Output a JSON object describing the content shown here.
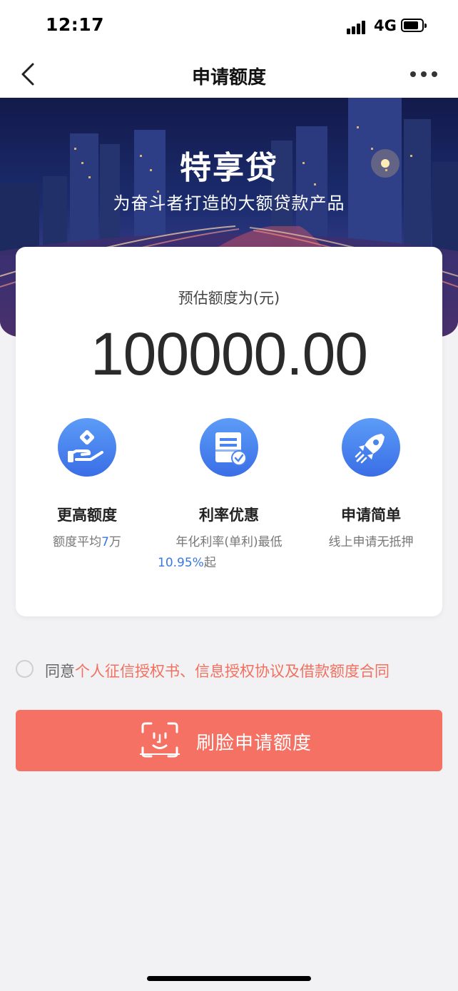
{
  "status_bar": {
    "time": "12:17",
    "network": "4G"
  },
  "nav": {
    "title": "申请额度"
  },
  "hero": {
    "title": "特享贷",
    "subtitle": "为奋斗者打造的大额贷款产品"
  },
  "card": {
    "amount_label": "预估额度为(元)",
    "amount_value": "100000.00",
    "features": [
      {
        "icon": "hand-coin-icon",
        "title": "更高额度",
        "desc_prefix": "额度平均",
        "desc_highlight": "7",
        "desc_suffix": "万"
      },
      {
        "icon": "document-check-icon",
        "title": "利率优惠",
        "desc_line1": "年化利率(单利)最低",
        "desc_highlight": "10.95%",
        "desc_suffix": "起"
      },
      {
        "icon": "rocket-icon",
        "title": "申请简单",
        "desc": "线上申请无抵押"
      }
    ]
  },
  "agreement": {
    "prefix": "同意",
    "link_text": "个人征信授权书、信息授权协议及借款额度合同"
  },
  "apply_button": {
    "label": "刷脸申请额度"
  },
  "colors": {
    "accent_button": "#f57163",
    "link_red": "#f2705f",
    "highlight_blue": "#3a78e0",
    "icon_blue": "#4a84ef"
  }
}
